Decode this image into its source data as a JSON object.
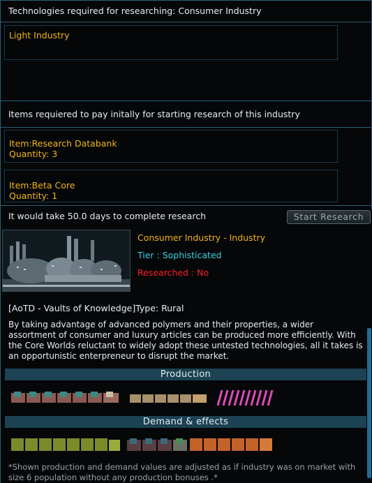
{
  "header": {
    "title": "Technologies required for researching: Consumer Industry"
  },
  "required_techs": [
    "Light Industry"
  ],
  "items_section": {
    "title": "Items requiered to pay initally for starting research of this industry",
    "items": [
      {
        "name": "Item:Research Databank",
        "quantity": "Quantity: 3"
      },
      {
        "name": "Item:Beta Core",
        "quantity": "Quantity: 1"
      }
    ]
  },
  "research": {
    "time_text": "It would take 50.0 days to complete research",
    "button_label": "Start Research"
  },
  "industry": {
    "name": "Consumer Industry - Industry",
    "tier": "Tier : Sophisticated",
    "researched": "Researched : No",
    "type_line": "[AoTD - Vaults of Knowledge]Type: Rural",
    "description": "By taking advantage of advanced polymers and their properties, a wider assortment of consumer and luxury articles can be produced more efficiently. With the Core Worlds reluctant to widely adopt these untested technologies, all it takes is an opportunistic enterpreneur to disrupt the market."
  },
  "production": {
    "title": "Production",
    "groups": [
      {
        "icon": "domestic-goods-icon",
        "count": 6
      },
      {
        "icon": "luxury-goods-icon",
        "count": 6
      },
      {
        "icon": "drugs-icon",
        "count": 6
      }
    ]
  },
  "demand": {
    "title": "Demand & effects",
    "groups": [
      {
        "icon": "organics-icon",
        "count": 7
      },
      {
        "icon": "heavy-machinery-icon",
        "count": 4
      },
      {
        "icon": "supplies-icon",
        "count": 6
      }
    ]
  },
  "footnote": "*Shown production and demand values are adjusted as if industry was on market with size 6 population without any production bonuses .*",
  "colors": {
    "accent_yellow": "#f2b514",
    "tier_cyan": "#35d1de",
    "status_red": "#ff1e1e",
    "bar_bg": "#1c4253"
  }
}
